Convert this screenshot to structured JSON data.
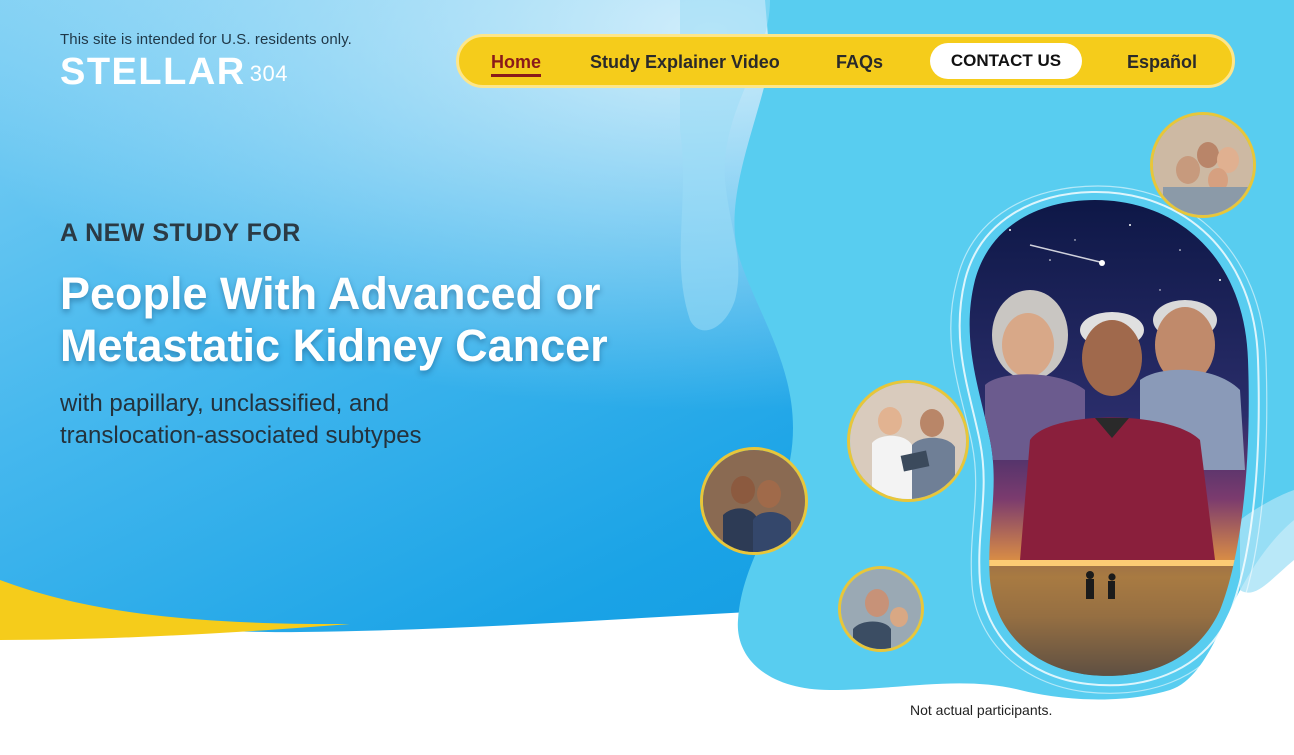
{
  "header": {
    "residency_note": "This site is intended for U.S. residents only.",
    "logo_text": "STELLAR",
    "logo_number": "304"
  },
  "nav": {
    "items": [
      {
        "label": "Home",
        "active": true
      },
      {
        "label": "Study Explainer Video"
      },
      {
        "label": "FAQs"
      },
      {
        "label": "CONTACT US"
      },
      {
        "label": "Español"
      }
    ]
  },
  "hero": {
    "kicker": "A NEW STUDY FOR",
    "headline_line1": "People With Advanced or",
    "headline_line2": "Metastatic Kidney Cancer",
    "subline_line1": "with papillary, unclassified, and",
    "subline_line2": "translocation-associated subtypes"
  },
  "disclaimer": "Not actual participants.",
  "colors": {
    "sky_blue": "#1da7e8",
    "light_blue": "#5dd0f0",
    "accent_yellow": "#f5cc1b",
    "active_nav": "#8a1a1a"
  },
  "images": [
    "family-group-photo",
    "doctor-patient-tablet-photo",
    "couple-kitchen-photo",
    "grandfather-grandchild-photo",
    "patients-and-sunset-collage"
  ]
}
